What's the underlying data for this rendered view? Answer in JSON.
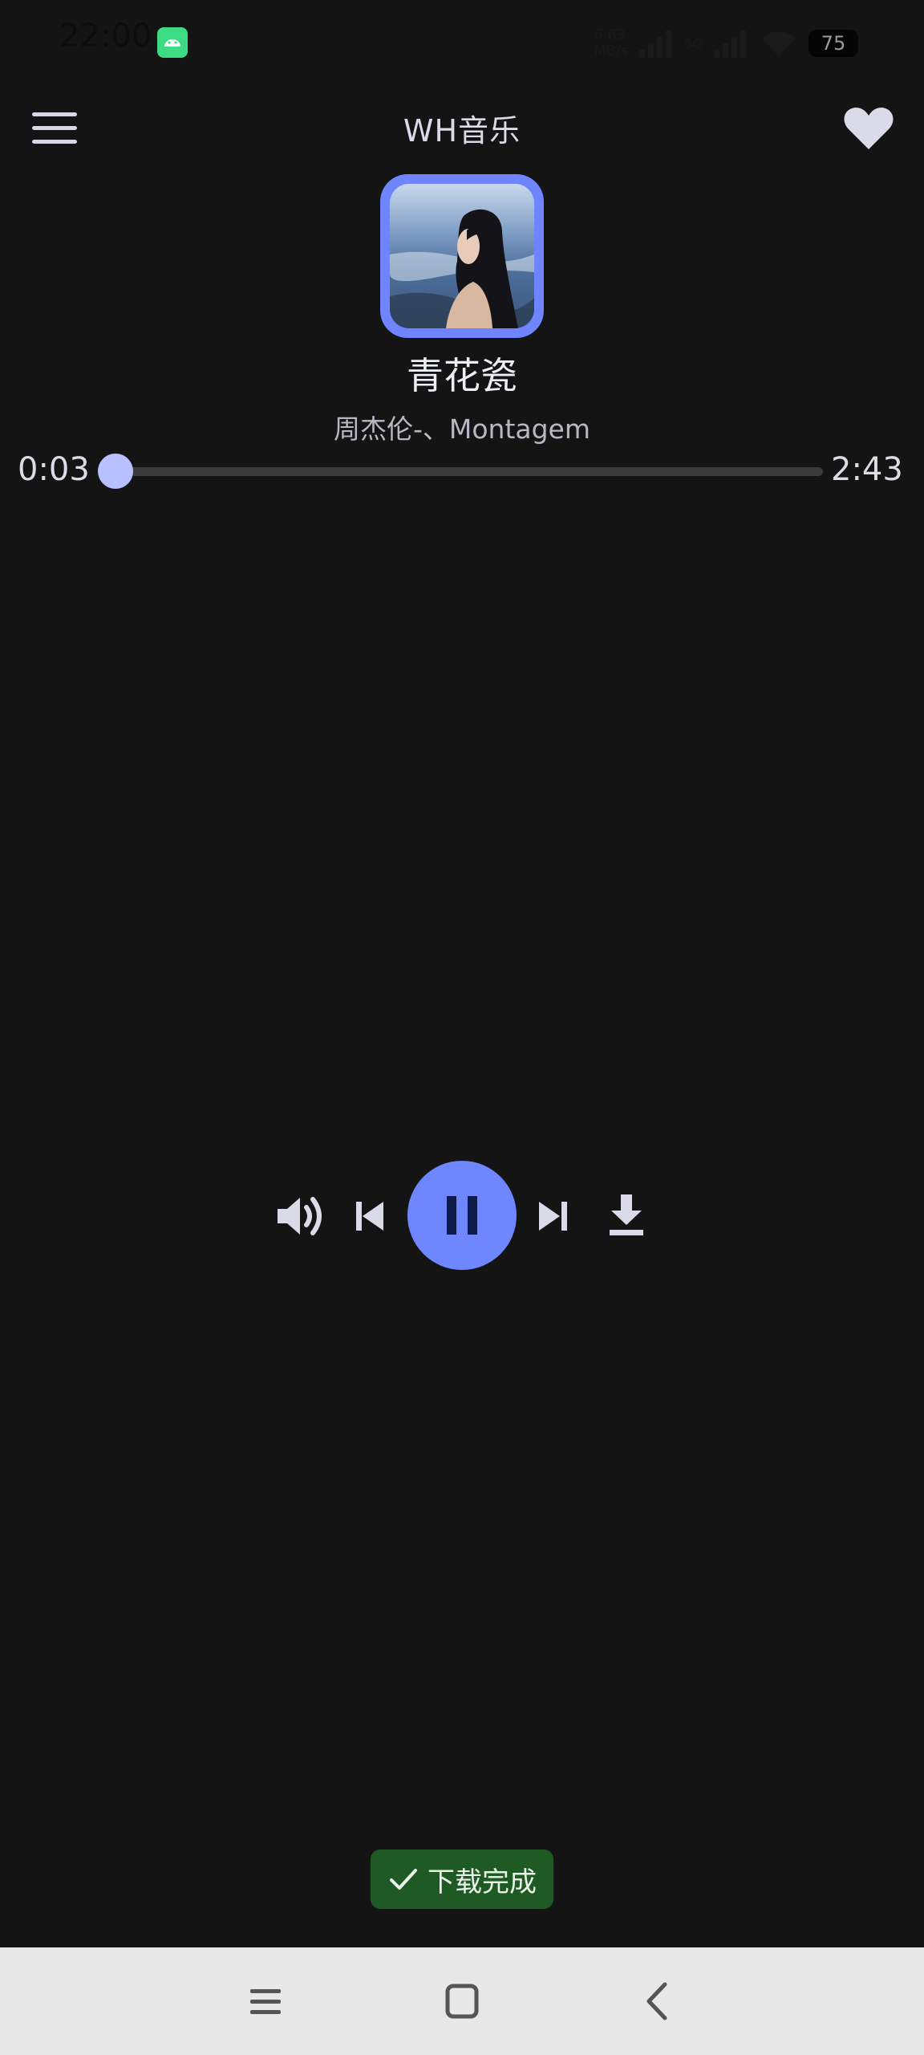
{
  "status_bar": {
    "time": "22:00",
    "net_speed_value": "6.63",
    "net_speed_unit": "MB/s",
    "network_type": "5G",
    "battery": "75"
  },
  "header": {
    "title": "WH音乐",
    "menu_icon": "hamburger-menu-icon",
    "favorite_icon": "heart-icon"
  },
  "song": {
    "title": "青花瓷",
    "artist": "周杰伦-、Montagem"
  },
  "progress": {
    "current": "0:03",
    "total": "2:43",
    "fraction": 0.02
  },
  "controls": {
    "volume_icon": "volume-icon",
    "previous_icon": "skip-previous-icon",
    "play_state_icon": "pause-icon",
    "next_icon": "skip-next-icon",
    "download_icon": "download-icon"
  },
  "toast": {
    "text": "下载完成",
    "icon": "check-icon"
  },
  "colors": {
    "background": "#141414",
    "accent": "#6e86ff",
    "progress": "#b9c0ff",
    "toast_bg": "#1f5a24"
  }
}
